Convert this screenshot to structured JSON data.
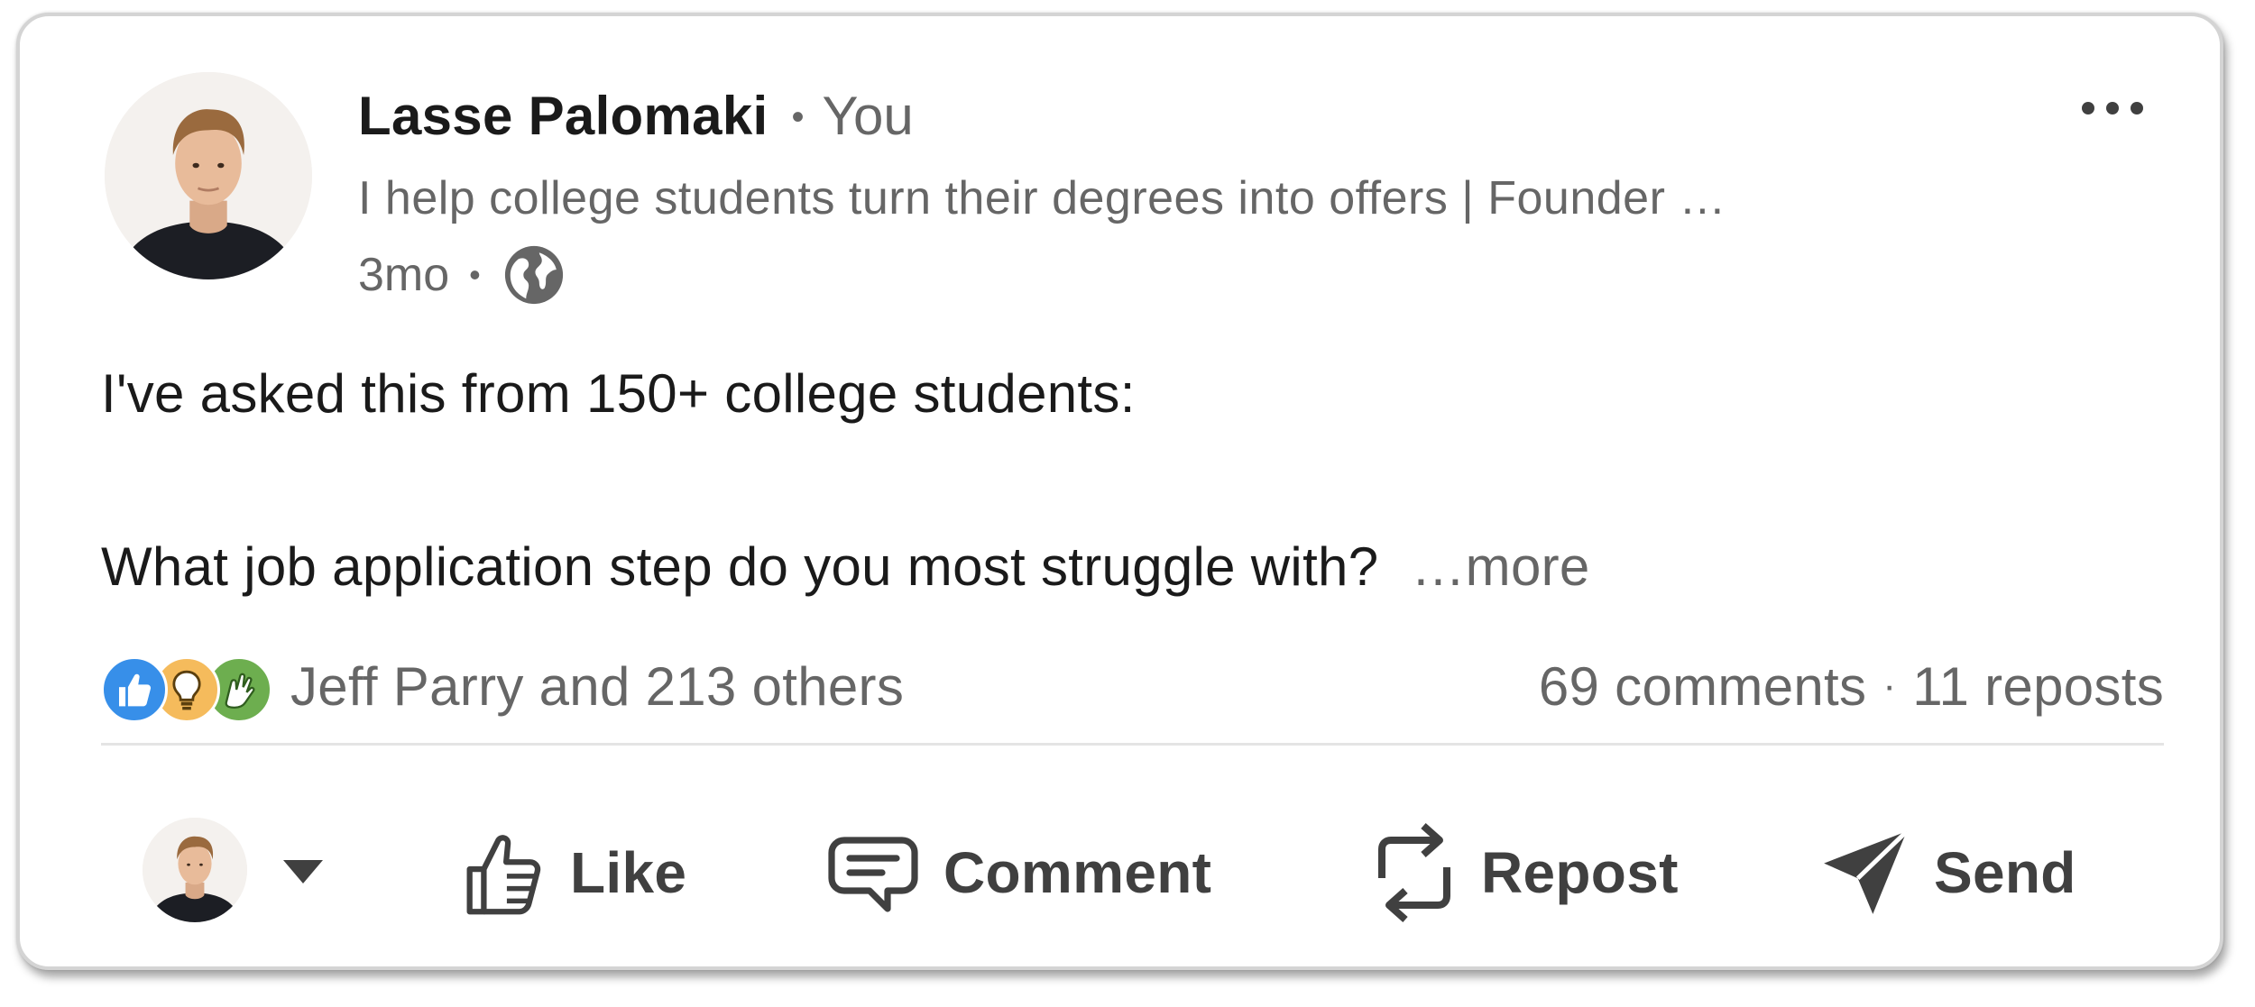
{
  "post": {
    "author": {
      "name": "Lasse Palomaki",
      "relation": "You",
      "headline": "I help college students turn their degrees into offers | Founder …",
      "time": "3mo",
      "visibility_icon": "globe-icon"
    },
    "menu_icon": "more-horizontal-icon",
    "body": {
      "line1": "I've asked this from 150+ college students:",
      "line2": "What job application step do you most struggle with?",
      "see_more": "…more"
    },
    "reactions": {
      "icons": [
        "like-reaction-icon",
        "insightful-reaction-icon",
        "celebrate-reaction-icon"
      ],
      "summary": "Jeff Parry and 213 others"
    },
    "counts": {
      "comments": "69 comments",
      "separator": "·",
      "reposts": "11 reposts"
    },
    "actions": {
      "actor_icon": "avatar",
      "actor_caret_icon": "caret-down-icon",
      "like": "Like",
      "comment": "Comment",
      "repost": "Repost",
      "send": "Send"
    }
  },
  "colors": {
    "name_text": "#1a1a1a",
    "secondary_text": "#666666",
    "action_text": "#404040",
    "like_blue": "#378fe9",
    "insight_gold": "#f5bb5c",
    "celebrate_green": "#6dae4f"
  }
}
